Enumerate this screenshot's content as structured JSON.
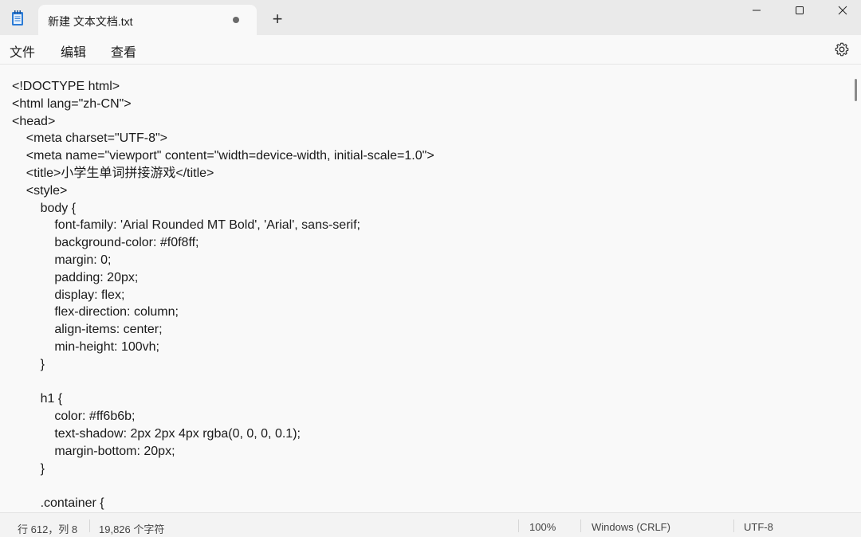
{
  "window": {
    "tab_title": "新建 文本文档.txt",
    "new_tab_label": "+",
    "icons": [
      "notepad-app-icon",
      "unsaved-dot-icon",
      "minimize-icon",
      "maximize-icon",
      "close-icon",
      "settings-gear-icon"
    ]
  },
  "menu": {
    "file": "文件",
    "edit": "编辑",
    "view": "查看"
  },
  "editor": {
    "lines": [
      "<!DOCTYPE html>",
      "<html lang=\"zh-CN\">",
      "<head>",
      "    <meta charset=\"UTF-8\">",
      "    <meta name=\"viewport\" content=\"width=device-width, initial-scale=1.0\">",
      "    <title>小学生单词拼接游戏</title>",
      "    <style>",
      "        body {",
      "            font-family: 'Arial Rounded MT Bold', 'Arial', sans-serif;",
      "            background-color: #f0f8ff;",
      "            margin: 0;",
      "            padding: 20px;",
      "            display: flex;",
      "            flex-direction: column;",
      "            align-items: center;",
      "            min-height: 100vh;",
      "        }",
      "",
      "        h1 {",
      "            color: #ff6b6b;",
      "            text-shadow: 2px 2px 4px rgba(0, 0, 0, 0.1);",
      "            margin-bottom: 20px;",
      "        }",
      "",
      "        .container {"
    ]
  },
  "status": {
    "position": "行 612，列 8",
    "char_count": "19,826 个字符",
    "zoom": "100%",
    "line_ending": "Windows (CRLF)",
    "encoding": "UTF-8"
  }
}
